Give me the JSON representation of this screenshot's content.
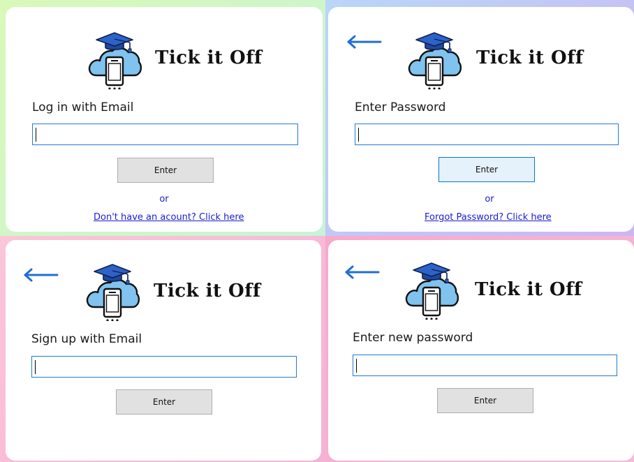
{
  "app": {
    "name": "Tick it Off",
    "logo_icon": "graduation-cap-cloud-phone-icon",
    "back_icon": "left-arrow-icon",
    "accent_color": "#1f7cd6",
    "link_color": "#1a1ad2"
  },
  "screens": {
    "login": {
      "prompt": "Log in with Email",
      "input_value": "",
      "button_label": "Enter",
      "or_label": "or",
      "link_text": "Don't have an acount? Click here"
    },
    "password": {
      "prompt": "Enter Password",
      "input_value": "",
      "button_label": "Enter",
      "or_label": "or",
      "link_text": "Forgot Password? Click here"
    },
    "signup": {
      "prompt": "Sign up with Email",
      "input_value": "",
      "button_label": "Enter"
    },
    "new_password": {
      "prompt": "Enter new password",
      "input_value": "",
      "button_label": "Enter"
    }
  }
}
